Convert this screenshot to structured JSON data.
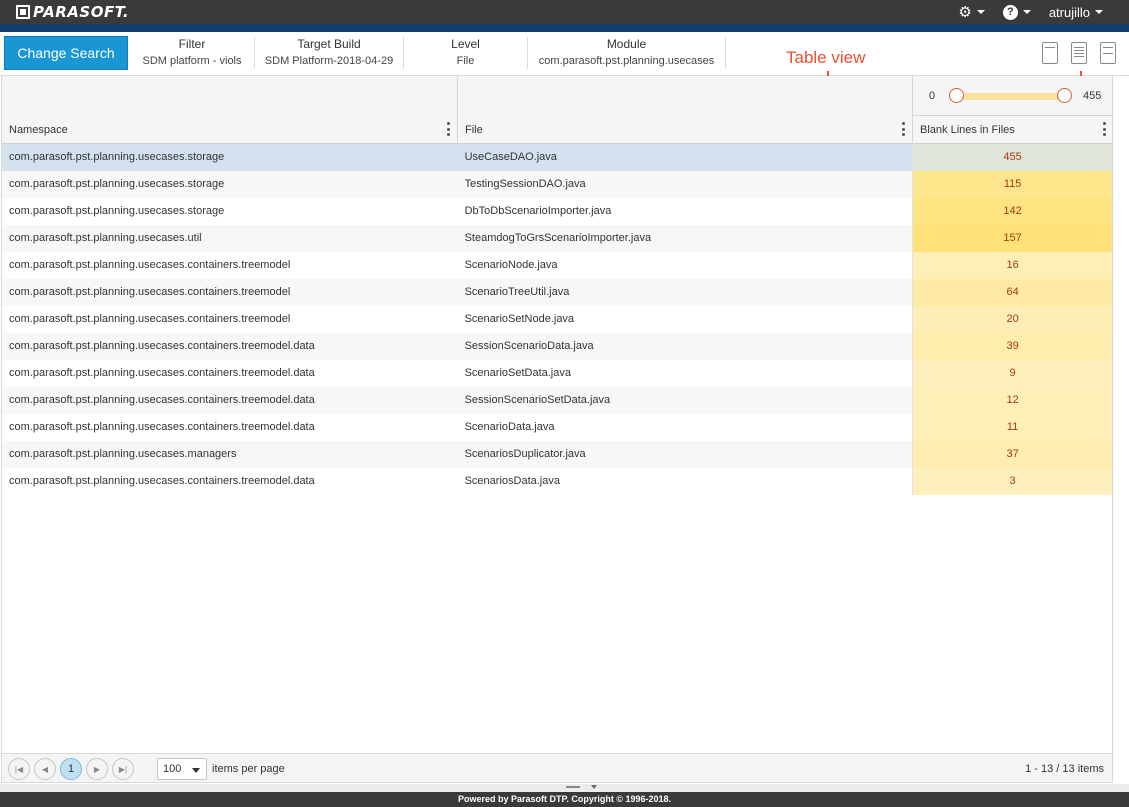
{
  "app": {
    "logo_text": "PARASOFT.",
    "username": "atrujillo",
    "accent_color": "#1b96d4",
    "topbar_color": "#3a3a3a",
    "header_band_color": "#0f3f6a"
  },
  "topbar": {
    "settings_icon": "gear-icon",
    "help_icon": "help-icon",
    "help_glyph": "?",
    "gear_glyph": "⚙"
  },
  "search": {
    "change_search_label": "Change Search",
    "criteria": [
      {
        "title": "Filter",
        "value": "SDM platform - viols"
      },
      {
        "title": "Target Build",
        "value": "SDM Platform-2018-04-29"
      },
      {
        "title": "Level",
        "value": "File"
      },
      {
        "title": "Module",
        "value": "com.parasoft.pst.planning.usecases"
      }
    ]
  },
  "annotation": {
    "label": "Table view",
    "color": "#ef5030"
  },
  "view_buttons": [
    "summary-view-icon",
    "table-view-icon",
    "detail-view-icon"
  ],
  "grid": {
    "columns": [
      "Namespace",
      "File",
      "Blank Lines in Files"
    ],
    "range_filter": {
      "min": "0",
      "max": "455"
    },
    "rows": [
      {
        "namespace": "com.parasoft.pst.planning.usecases.storage",
        "file": "UseCaseDAO.java",
        "value": "455",
        "selected": true
      },
      {
        "namespace": "com.parasoft.pst.planning.usecases.storage",
        "file": "TestingSessionDAO.java",
        "value": "115"
      },
      {
        "namespace": "com.parasoft.pst.planning.usecases.storage",
        "file": "DbToDbScenarioImporter.java",
        "value": "142"
      },
      {
        "namespace": "com.parasoft.pst.planning.usecases.util",
        "file": "SteamdogToGrsScenarioImporter.java",
        "value": "157"
      },
      {
        "namespace": "com.parasoft.pst.planning.usecases.containers.treemodel",
        "file": "ScenarioNode.java",
        "value": "16"
      },
      {
        "namespace": "com.parasoft.pst.planning.usecases.containers.treemodel",
        "file": "ScenarioTreeUtil.java",
        "value": "64"
      },
      {
        "namespace": "com.parasoft.pst.planning.usecases.containers.treemodel",
        "file": "ScenarioSetNode.java",
        "value": "20"
      },
      {
        "namespace": "com.parasoft.pst.planning.usecases.containers.treemodel.data",
        "file": "SessionScenarioData.java",
        "value": "39"
      },
      {
        "namespace": "com.parasoft.pst.planning.usecases.containers.treemodel.data",
        "file": "ScenarioSetData.java",
        "value": "9"
      },
      {
        "namespace": "com.parasoft.pst.planning.usecases.containers.treemodel.data",
        "file": "SessionScenarioSetData.java",
        "value": "12"
      },
      {
        "namespace": "com.parasoft.pst.planning.usecases.containers.treemodel.data",
        "file": "ScenarioData.java",
        "value": "11"
      },
      {
        "namespace": "com.parasoft.pst.planning.usecases.managers",
        "file": "ScenariosDuplicator.java",
        "value": "37"
      },
      {
        "namespace": "com.parasoft.pst.planning.usecases.containers.treemodel.data",
        "file": "ScenariosData.java",
        "value": "3"
      }
    ]
  },
  "pager": {
    "first_glyph": "|◀",
    "prev_glyph": "◀",
    "current_page": "1",
    "next_glyph": "▶",
    "last_glyph": "▶|",
    "page_size": "100",
    "page_size_label": "items per page",
    "info": "1 - 13 / 13 items"
  },
  "footer": {
    "text": "Powered by Parasoft DTP. Copyright © 1996-2018."
  }
}
